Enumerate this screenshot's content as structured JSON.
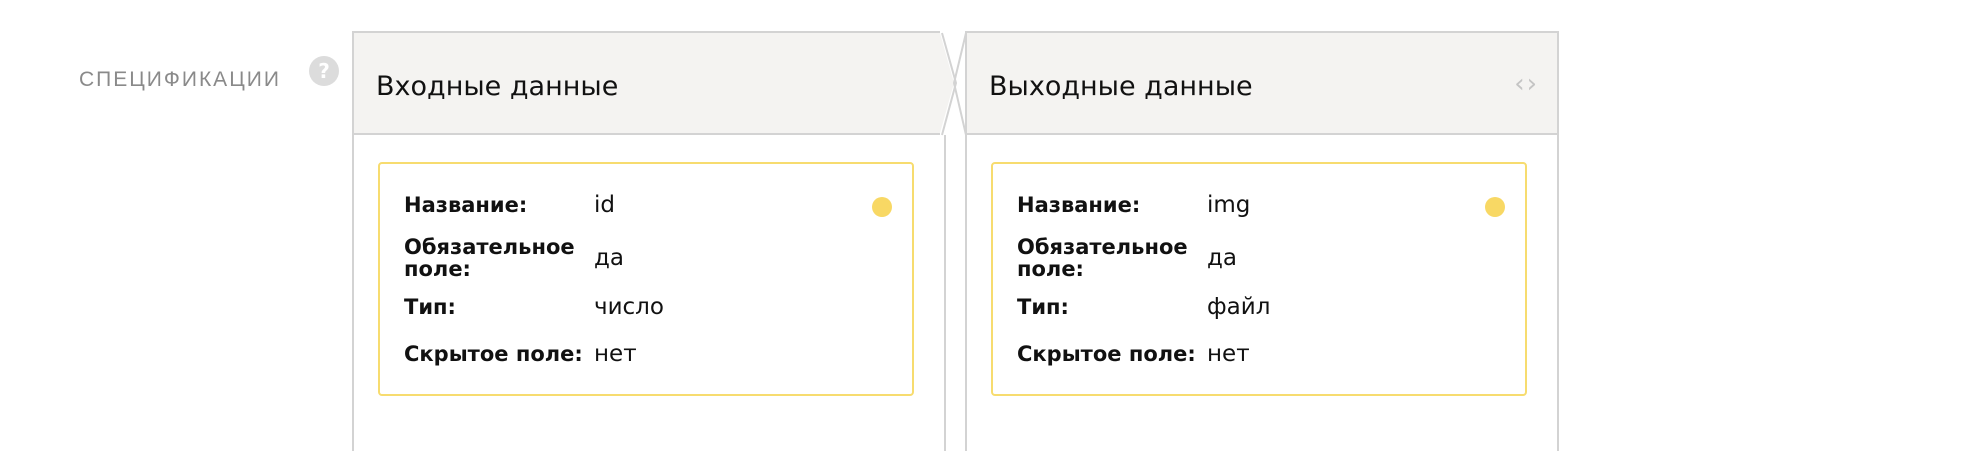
{
  "section": {
    "label": "СПЕЦИФИКАЦИИ",
    "help_icon": "?"
  },
  "input_panel": {
    "title": "Входные данные",
    "field": {
      "name_label": "Название:",
      "name_value": "id",
      "required_label": "Обязательное поле:",
      "required_value": "да",
      "type_label": "Тип:",
      "type_value": "число",
      "hidden_label": "Скрытое поле:",
      "hidden_value": "нет",
      "status_color": "#f8d864"
    }
  },
  "output_panel": {
    "title": "Выходные данные",
    "code_toggle_icon": "‹›",
    "field": {
      "name_label": "Название:",
      "name_value": "img",
      "required_label": "Обязательное поле:",
      "required_value": "да",
      "type_label": "Тип:",
      "type_value": "файл",
      "hidden_label": "Скрытое поле:",
      "hidden_value": "нет",
      "status_color": "#f8d864"
    }
  },
  "colors": {
    "card_border": "#f7dc6f",
    "header_background": "#f4f3f1",
    "panel_border": "#d3d3d3"
  }
}
